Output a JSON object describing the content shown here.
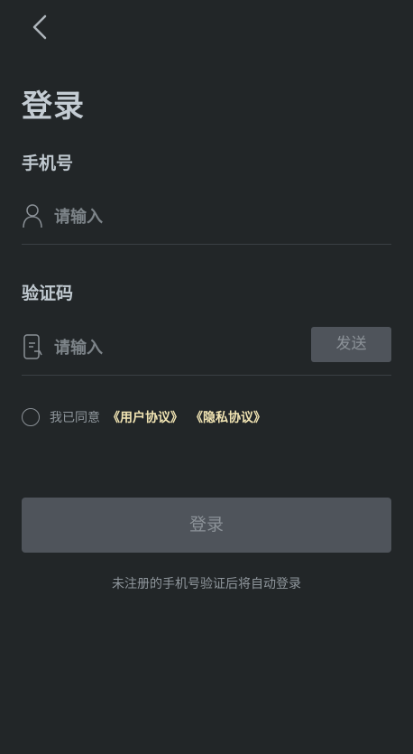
{
  "nav": {
    "back_icon": "chevron-left-icon"
  },
  "title": "登录",
  "phone": {
    "label": "手机号",
    "placeholder": "请输入",
    "icon": "user-icon"
  },
  "code": {
    "label": "验证码",
    "placeholder": "请输入",
    "icon": "phone-message-icon",
    "send_label": "发送"
  },
  "agreement": {
    "text": "我已同意",
    "user_agreement": "《用户协议》",
    "privacy_agreement": "《隐私协议》"
  },
  "login_button": "登录",
  "hint": "未注册的手机号验证后将自动登录",
  "colors": {
    "background": "#222628",
    "button": "#4f545b",
    "link": "#f1e4b3",
    "divider": "#3a4044"
  }
}
